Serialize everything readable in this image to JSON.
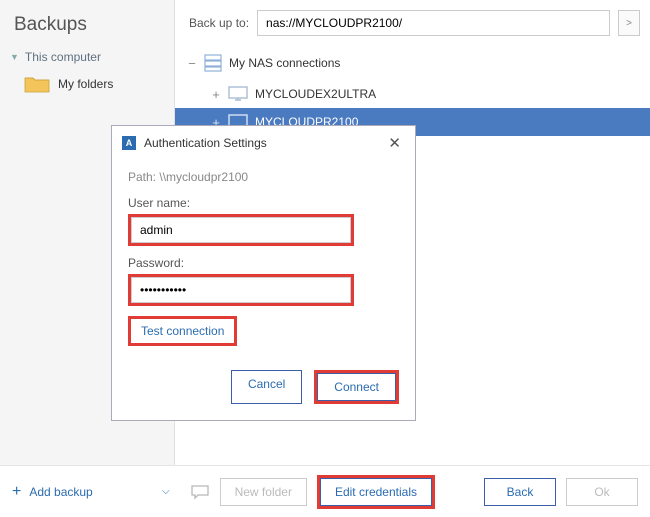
{
  "sidebar": {
    "title": "Backups",
    "root_label": "This computer",
    "folder_label": "My folders"
  },
  "topbar": {
    "label": "Back up to:",
    "path_value": "nas://MYCLOUDPR2100/",
    "expand_glyph": ">"
  },
  "tree": {
    "root_label": "My NAS connections",
    "item1": "MYCLOUDEX2ULTRA",
    "item2": "MYCLOUDPR2100"
  },
  "dialog": {
    "icon_letter": "A",
    "title": "Authentication Settings",
    "path_prefix": "Path:",
    "path_value": "\\\\mycloudpr2100",
    "user_label": "User name:",
    "user_value": "admin",
    "pass_label": "Password:",
    "pass_value": "•••••••••••",
    "test_label": "Test connection",
    "cancel": "Cancel",
    "connect": "Connect"
  },
  "bottombar": {
    "add_backup": "Add backup",
    "new_folder": "New folder",
    "edit_credentials": "Edit credentials",
    "back": "Back",
    "ok": "Ok"
  }
}
